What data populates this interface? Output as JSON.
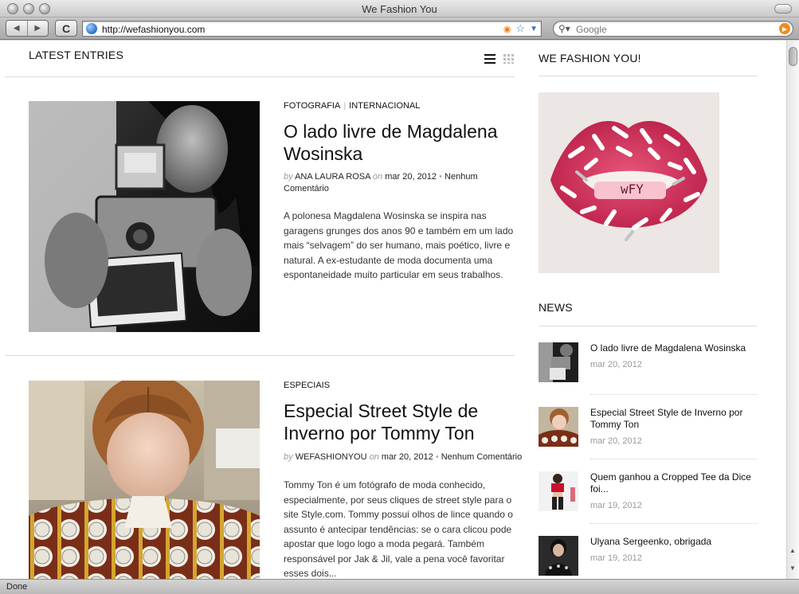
{
  "window": {
    "title": "We Fashion You"
  },
  "toolbar": {
    "back_label": "◀",
    "forward_label": "▶",
    "reload_label": "C",
    "url": "http://wefashionyou.com",
    "search_placeholder": "Google"
  },
  "status": {
    "text": "Done"
  },
  "main": {
    "heading": "LATEST ENTRIES",
    "posts": [
      {
        "categories": [
          "FOTOGRAFIA",
          "INTERNACIONAL"
        ],
        "title": "O lado livre de Magdalena Wosinska",
        "by": "by",
        "author": "ANA LAURA ROSA",
        "on": "on",
        "date": "mar 20, 2012",
        "comments": "Nenhum Comentário",
        "excerpt": "A polonesa Magdalena Wosinska se inspira nas garagens grunges dos anos 90 e também em um lado mais “selvagem” do ser humano, mais poético,  livre e natural. A ex-estudante de moda documenta uma espontaneidade muito particular em seus trabalhos."
      },
      {
        "categories": [
          "ESPECIAIS"
        ],
        "title": "Especial Street Style de Inverno por Tommy Ton",
        "by": "by",
        "author": "WEFASHIONYOU",
        "on": "on",
        "date": "mar 20, 2012",
        "comments": "Nenhum Comentário",
        "excerpt": "Tommy Ton é um  fotógrafo de moda conhecido, especialmente, por seus cliques de street style para o site Style.com. Tommy possui olhos de lince quando o assunto é antecipar tendências: se o cara clicou pode apostar que logo logo a moda pegará. Também responsável por Jak & Jil, vale a pena você favoritar esses dois..."
      }
    ]
  },
  "sidebar": {
    "heading": "WE FASHION YOU!",
    "feature_logo_text": "wFY",
    "news_heading": "NEWS",
    "news": [
      {
        "title": "O lado livre de Magdalena Wosinska",
        "date": "mar 20, 2012"
      },
      {
        "title": "Especial Street Style de Inverno por Tommy Ton",
        "date": "mar 20, 2012"
      },
      {
        "title": "Quem ganhou a Cropped Tee da Dice foi...",
        "date": "mar 19, 2012"
      },
      {
        "title": "Ulyana Sergeenko, obrigada",
        "date": "mar 19, 2012"
      }
    ]
  }
}
